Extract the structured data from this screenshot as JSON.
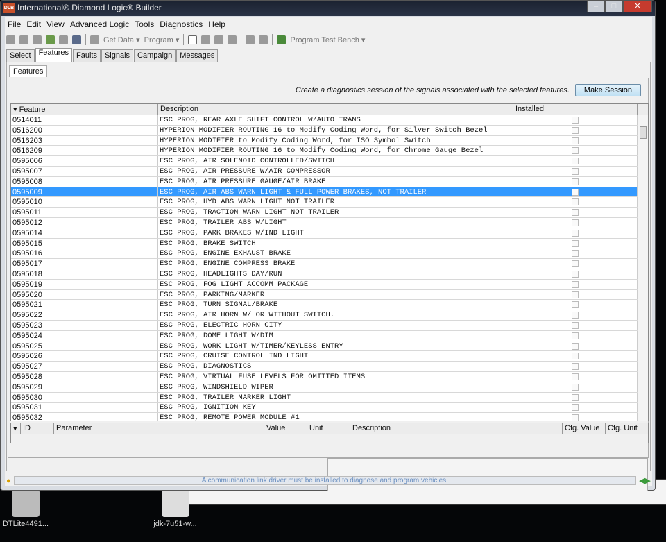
{
  "window": {
    "title": "International® Diamond Logic® Builder",
    "logo": "DLB"
  },
  "menu": [
    "File",
    "Edit",
    "View",
    "Advanced Logic",
    "Tools",
    "Diagnostics",
    "Help"
  ],
  "toolbar": {
    "get_data": "Get Data ▾",
    "program": "Program ▾",
    "test_bench": "Program Test Bench ▾"
  },
  "tabs": [
    "Select",
    "Features",
    "Faults",
    "Signals",
    "Campaign",
    "Messages"
  ],
  "subtab": "Features",
  "session": {
    "hint": "Create a diagnostics session of the signals associated with the selected features.",
    "button": "Make Session"
  },
  "features_table": {
    "headers": [
      "Feature",
      "Description",
      "Installed"
    ],
    "rows": [
      [
        "0514011",
        "ESC PROG, REAR AXLE SHIFT CONTROL W/AUTO TRANS"
      ],
      [
        "0516200",
        "HYPERION MODIFIER ROUTING 16 to Modify Coding Word, for Silver Switch Bezel"
      ],
      [
        "0516203",
        "HYPERION MODIFIER to Modify Coding Word, for ISO Symbol Switch"
      ],
      [
        "0516209",
        "HYPERION MODIFIER ROUTING 16 to Modify Coding Word, for Chrome Gauge Bezel"
      ],
      [
        "0595006",
        "ESC PROG, AIR SOLENOID CONTROLLED/SWITCH"
      ],
      [
        "0595007",
        "ESC PROG, AIR PRESSURE W/AIR COMPRESSOR"
      ],
      [
        "0595008",
        "ESC PROG, AIR PRESSURE GAUGE/AIR BRAKE"
      ],
      [
        "0595009",
        "ESC PROG, AIR ABS WARN LIGHT & FULL POWER BRAKES, NOT TRAILER"
      ],
      [
        "0595010",
        "ESC PROG, HYD ABS WARN LIGHT NOT TRAILER"
      ],
      [
        "0595011",
        "ESC PROG, TRACTION WARN LIGHT NOT TRAILER"
      ],
      [
        "0595012",
        "ESC PROG, TRAILER ABS W/LIGHT"
      ],
      [
        "0595014",
        "ESC PROG, PARK BRAKES W/IND LIGHT"
      ],
      [
        "0595015",
        "ESC PROG, BRAKE SWITCH"
      ],
      [
        "0595016",
        "ESC PROG, ENGINE EXHAUST BRAKE"
      ],
      [
        "0595017",
        "ESC PROG, ENGINE COMPRESS BRAKE"
      ],
      [
        "0595018",
        "ESC PROG, HEADLIGHTS DAY/RUN"
      ],
      [
        "0595019",
        "ESC PROG, FOG LIGHT ACCOMM PACKAGE"
      ],
      [
        "0595020",
        "ESC PROG, PARKING/MARKER"
      ],
      [
        "0595021",
        "ESC PROG, TURN SIGNAL/BRAKE"
      ],
      [
        "0595022",
        "ESC PROG, AIR HORN W/ OR WITHOUT SWITCH."
      ],
      [
        "0595023",
        "ESC PROG, ELECTRIC HORN CITY"
      ],
      [
        "0595024",
        "ESC PROG, DOME LIGHT W/DIM"
      ],
      [
        "0595025",
        "ESC PROG, WORK LIGHT W/TIMER/KEYLESS ENTRY"
      ],
      [
        "0595026",
        "ESC PROG, CRUISE CONTROL IND LIGHT"
      ],
      [
        "0595027",
        "ESC PROG, DIAGNOSTICS"
      ],
      [
        "0595028",
        "ESC PROG, VIRTUAL FUSE LEVELS FOR OMITTED ITEMS"
      ],
      [
        "0595029",
        "ESC PROG, WINDSHIELD WIPER"
      ],
      [
        "0595030",
        "ESC PROG, TRAILER MARKER LIGHT"
      ],
      [
        "0595031",
        "ESC PROG, IGNITION KEY"
      ],
      [
        "0595032",
        "ESC PROG, REMOTE POWER MODULE #1"
      ]
    ],
    "selected_index": 7
  },
  "params_table": {
    "headers": [
      "ID",
      "Parameter",
      "Value",
      "Unit",
      "Description",
      "Cfg. Value",
      "Cfg. Unit"
    ]
  },
  "status": "A communication link driver must be installed to diagnose and program vehicles.",
  "desktop": [
    "DTLite4491...",
    "jdk-7u51-w..."
  ]
}
